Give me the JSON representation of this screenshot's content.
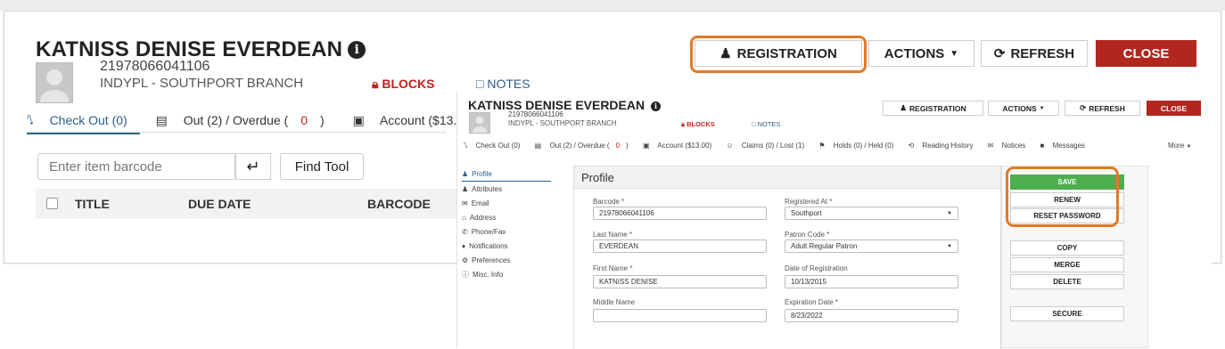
{
  "colors": {
    "close_red": "#b3261e",
    "link_blue": "#2b5c8a",
    "highlight_orange": "#e07a2a",
    "save_green": "#4cae4c"
  },
  "patron": {
    "name": "KATNISS DENISE EVERDEAN",
    "barcode": "21978066041106",
    "branch": "INDYPL - SOUTHPORT BRANCH",
    "blocks_label": "BLOCKS",
    "notes_label": "NOTES"
  },
  "header_buttons": {
    "registration": "REGISTRATION",
    "actions": "ACTIONS",
    "refresh": "REFRESH",
    "close": "CLOSE"
  },
  "tabs": {
    "checkout": "Check Out (0)",
    "out_prefix": "Out (2) / Overdue (",
    "overdue_count": "0",
    "out_suffix": ")",
    "account": "Account ($13.00)",
    "claims": "Claims (0) / Lost (1)",
    "holds": "Holds (0) / Held (0)",
    "reading_history": "Reading History",
    "notices": "Notices",
    "messages": "Messages",
    "more": "More"
  },
  "checkout": {
    "barcode_placeholder": "Enter item barcode",
    "find_tool": "Find Tool",
    "columns": [
      "TITLE",
      "DUE DATE",
      "BARCODE"
    ]
  },
  "sidebar": {
    "items": [
      {
        "label": "Profile",
        "icon": "user-icon"
      },
      {
        "label": "Attributes",
        "icon": "users-icon"
      },
      {
        "label": "Email",
        "icon": "envelope-icon"
      },
      {
        "label": "Address",
        "icon": "home-icon"
      },
      {
        "label": "Phone/Fax",
        "icon": "phone-icon"
      },
      {
        "label": "Notifications",
        "icon": "bell-icon"
      },
      {
        "label": "Preferences",
        "icon": "cogs-icon"
      },
      {
        "label": "Misc. Info",
        "icon": "info-icon"
      }
    ]
  },
  "profile": {
    "title": "Profile",
    "fields": {
      "barcode": {
        "label": "Barcode *",
        "value": "21978066041106"
      },
      "registered_at": {
        "label": "Registered At *",
        "value": "Southport"
      },
      "last_name": {
        "label": "Last Name *",
        "value": "EVERDEAN"
      },
      "patron_code": {
        "label": "Patron Code *",
        "value": "Adult Regular Patron"
      },
      "first_name": {
        "label": "First Name *",
        "value": "KATNISS DENISE"
      },
      "date_of_registration": {
        "label": "Date of Registration",
        "value": "10/13/2015"
      },
      "middle_name": {
        "label": "Middle Name",
        "value": ""
      },
      "expiration_date": {
        "label": "Expiration Date *",
        "value": "8/23/2022"
      }
    }
  },
  "right_actions": {
    "save": "SAVE",
    "renew": "RENEW",
    "reset_password": "RESET PASSWORD",
    "copy": "COPY",
    "merge": "MERGE",
    "delete": "DELETE",
    "secure": "SECURE"
  }
}
